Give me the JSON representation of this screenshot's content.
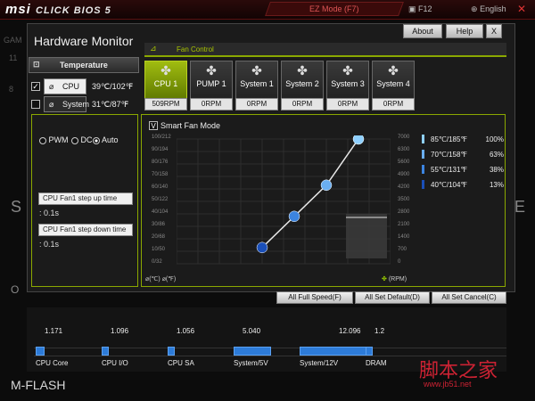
{
  "topbar": {
    "brand": "msi",
    "product": "CLICK BIOS 5",
    "ez_mode": "EZ Mode (F7)",
    "f12": "F12",
    "language": "English"
  },
  "background": {
    "left_labels": [
      "GAM",
      "11",
      "8",
      "S",
      "O",
      "M-FLASH"
    ],
    "right_label": "E"
  },
  "window": {
    "title": "Hardware Monitor",
    "about": "About",
    "help": "Help",
    "close": "X"
  },
  "temperature": {
    "header": "Temperature",
    "sensors": [
      {
        "name": "CPU",
        "value": "39℃/102℉",
        "checked": true,
        "active": true
      },
      {
        "name": "System",
        "value": "31℃/87℉",
        "checked": false,
        "active": false
      }
    ]
  },
  "fan_control": {
    "header": "Fan Control",
    "fans": [
      {
        "name": "CPU 1",
        "rpm": "509RPM"
      },
      {
        "name": "PUMP 1",
        "rpm": "0RPM"
      },
      {
        "name": "System 1",
        "rpm": "0RPM"
      },
      {
        "name": "System 2",
        "rpm": "0RPM"
      },
      {
        "name": "System 3",
        "rpm": "0RPM"
      },
      {
        "name": "System 4",
        "rpm": "0RPM"
      }
    ],
    "mode_options": [
      "PWM",
      "DC",
      "Auto"
    ],
    "selected_mode": "Auto",
    "step_up_label": "CPU Fan1 step up time",
    "step_up_value": ": 0.1s",
    "step_down_label": "CPU Fan1 step down time",
    "step_down_value": ": 0.1s",
    "smart_fan_label": "Smart Fan Mode",
    "smart_fan_checked": "V"
  },
  "chart_data": {
    "type": "line",
    "y_left_ticks": [
      "100/212",
      "90/194",
      "80/176",
      "70/158",
      "60/140",
      "50/122",
      "40/104",
      "30/86",
      "20/68",
      "10/50",
      "0/32"
    ],
    "y_right_ticks": [
      "7000",
      "6300",
      "5600",
      "4900",
      "4200",
      "3500",
      "2800",
      "2100",
      "1400",
      "700",
      "0"
    ],
    "x_unit_label": "(℃)",
    "x_unit_label2": "(℉)",
    "rpm_label": "(RPM)",
    "points": [
      {
        "temp_c": 40,
        "percent": 13
      },
      {
        "temp_c": 55,
        "percent": 38
      },
      {
        "temp_c": 70,
        "percent": 63
      },
      {
        "temp_c": 85,
        "percent": 100
      }
    ],
    "legend": [
      {
        "temp": "85℃/185℉",
        "percent": "100%",
        "color": "#8fd0ff"
      },
      {
        "temp": "70℃/158℉",
        "percent": "63%",
        "color": "#6aaef0"
      },
      {
        "temp": "55℃/131℉",
        "percent": "38%",
        "color": "#3c84e0"
      },
      {
        "temp": "40℃/104℉",
        "percent": "13%",
        "color": "#1a4fb8"
      }
    ]
  },
  "actions": {
    "full_speed": "All Full Speed(F)",
    "set_default": "All Set Default(D)",
    "set_cancel": "All Set Cancel(C)"
  },
  "voltages": [
    {
      "label": "CPU Core",
      "value": "1.171"
    },
    {
      "label": "CPU I/O",
      "value": "1.096"
    },
    {
      "label": "CPU SA",
      "value": "1.056"
    },
    {
      "label": "System/5V",
      "value": "5.040"
    },
    {
      "label": "System/12V",
      "value": "12.096"
    },
    {
      "label": "DRAM",
      "value": "1.2"
    }
  ],
  "watermark": {
    "text": "脚本之家",
    "url": "www.jb51.net"
  },
  "colors": {
    "accent": "#8ba800",
    "brand_red": "#c8102e",
    "bar_blue": "#2d7bd8"
  }
}
